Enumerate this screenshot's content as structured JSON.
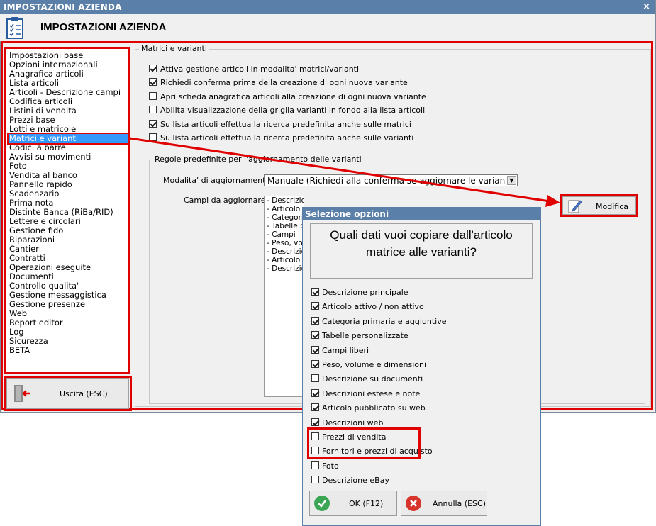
{
  "window": {
    "title": "IMPOSTAZIONI AZIENDA",
    "close_symbol": "×"
  },
  "header": {
    "title": "IMPOSTAZIONI AZIENDA",
    "icon": "checklist-icon"
  },
  "sidebar": {
    "items": [
      {
        "label": "Impostazioni base"
      },
      {
        "label": "Opzioni internazionali"
      },
      {
        "label": "Anagrafica articoli"
      },
      {
        "label": "Lista articoli"
      },
      {
        "label": "Articoli - Descrizione campi"
      },
      {
        "label": "Codifica articoli"
      },
      {
        "label": "Listini di vendita"
      },
      {
        "label": "Prezzi base"
      },
      {
        "label": "Lotti e matricole"
      },
      {
        "label": "Matrici e varianti"
      },
      {
        "label": "Codici a barre"
      },
      {
        "label": "Avvisi su movimenti"
      },
      {
        "label": "Foto"
      },
      {
        "label": "Vendita al banco"
      },
      {
        "label": "Pannello rapido"
      },
      {
        "label": "Scadenzario"
      },
      {
        "label": "Prima nota"
      },
      {
        "label": "Distinte Banca (RiBa/RID)"
      },
      {
        "label": "Lettere e circolari"
      },
      {
        "label": "Gestione fido"
      },
      {
        "label": "Riparazioni"
      },
      {
        "label": "Cantieri"
      },
      {
        "label": "Contratti"
      },
      {
        "label": "Operazioni eseguite"
      },
      {
        "label": "Documenti"
      },
      {
        "label": "Controllo qualita'"
      },
      {
        "label": "Gestione messaggistica"
      },
      {
        "label": "Gestione presenze"
      },
      {
        "label": "Web"
      },
      {
        "label": "Report editor"
      },
      {
        "label": "Log"
      },
      {
        "label": "Sicurezza"
      },
      {
        "label": "BETA"
      }
    ],
    "selected": "Matrici e varianti",
    "exit_label": "Uscita (ESC)"
  },
  "main": {
    "group_title": "Matrici e varianti",
    "options": [
      {
        "label": "Attiva gestione articoli in modalita' matrici/varianti",
        "checked": true
      },
      {
        "label": "Richiedi conferma prima della creazione di ogni nuova variante",
        "checked": true
      },
      {
        "label": "Apri scheda anagrafica articoli alla creazione di ogni nuova variante",
        "checked": false
      },
      {
        "label": "Abilita visualizzazione della griglia varianti in fondo alla lista articoli",
        "checked": false
      },
      {
        "label": "Su lista articoli effettua la ricerca predefinita anche sulle matrici",
        "checked": true
      },
      {
        "label": "Su lista articoli effettua la ricerca predefinita anche sulle varianti",
        "checked": false
      }
    ],
    "rules": {
      "title": "Regole predefinite per l'aggiornamento delle varianti",
      "mode_label": "Modalita' di aggiornamento :",
      "mode_value": "Manuale (Richiedi alla conferma se aggiornare le varianti c",
      "fields_label": "Campi da aggiornare :",
      "fields": [
        "- Descrizione principale",
        "- Articolo a",
        "- Categoria",
        "- Tabelle pe",
        "- Campi libe",
        "- Peso, volu",
        "- Descrizio",
        "- Articolo p",
        "- Descrizio"
      ],
      "modify_label": "Modifica"
    }
  },
  "dialog": {
    "title": "Selezione opzioni",
    "question_line1": "Quali dati vuoi copiare dall'articolo",
    "question_line2": "matrice alle varianti?",
    "options": [
      {
        "label": "Descrizione principale",
        "checked": true
      },
      {
        "label": "Articolo attivo / non attivo",
        "checked": true
      },
      {
        "label": "Categoria primaria e aggiuntive",
        "checked": true
      },
      {
        "label": "Tabelle personalizzate",
        "checked": true
      },
      {
        "label": "Campi liberi",
        "checked": true
      },
      {
        "label": "Peso, volume e dimensioni",
        "checked": true
      },
      {
        "label": "Descrizione su documenti",
        "checked": false
      },
      {
        "label": "Descrizioni estese e note",
        "checked": true
      },
      {
        "label": "Articolo pubblicato su web",
        "checked": true
      },
      {
        "label": "Descrizioni web",
        "checked": true
      },
      {
        "label": "Prezzi di vendita",
        "checked": false
      },
      {
        "label": "Fornitori e prezzi di acquisto",
        "checked": false
      },
      {
        "label": "Foto",
        "checked": false
      },
      {
        "label": "Descrizione eBay",
        "checked": false
      }
    ],
    "ok_label": "OK (F12)",
    "cancel_label": "Annulla (ESC)"
  },
  "colors": {
    "highlight": "#e00000",
    "titlebar": "#5a7fa8",
    "selection": "#3399ff",
    "ok_green": "#3aa655",
    "cancel_red": "#d9342b"
  }
}
